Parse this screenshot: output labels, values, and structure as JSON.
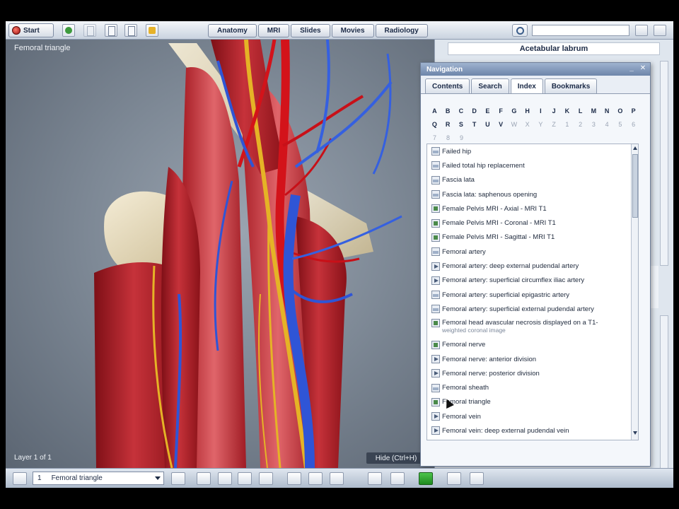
{
  "toolbar": {
    "start_label": "Start",
    "tabs": [
      "Anatomy",
      "MRI",
      "Slides",
      "Movies",
      "Radiology"
    ]
  },
  "viewer": {
    "title": "Femoral triangle",
    "footer_left": "Layer 1 of 1",
    "footer_right": "Hide (Ctrl+H)"
  },
  "right_pane": {
    "header": "Acetabular labrum"
  },
  "navigation": {
    "title": "Navigation",
    "tabs": [
      "Contents",
      "Search",
      "Index",
      "Bookmarks"
    ],
    "active_tab": "Index",
    "alphabet_row1": [
      "A",
      "B",
      "C",
      "D",
      "E",
      "F",
      "G",
      "H",
      "I",
      "J",
      "K",
      "L",
      "M",
      "N",
      "O",
      "P"
    ],
    "alphabet_row2": [
      "Q",
      "R",
      "S",
      "T",
      "U",
      "V",
      "W",
      "X",
      "Y",
      "Z",
      "1",
      "2",
      "3",
      "4",
      "5",
      "6"
    ],
    "alphabet_row3": [
      "7",
      "8",
      "9"
    ],
    "items": [
      {
        "label": "Failed hip",
        "icon": "image-icon"
      },
      {
        "label": "Failed total hip replacement",
        "icon": "image-icon"
      },
      {
        "label": "Fascia lata",
        "icon": "image-icon"
      },
      {
        "label": "Fascia lata: saphenous opening",
        "icon": "image-icon"
      },
      {
        "label": "Female Pelvis MRI - Axial - MRI T1",
        "icon": "mri-icon"
      },
      {
        "label": "Female Pelvis MRI - Coronal - MRI T1",
        "icon": "mri-icon"
      },
      {
        "label": "Female Pelvis MRI - Sagittal - MRI T1",
        "icon": "mri-icon"
      },
      {
        "label": "Femoral artery",
        "icon": "image-icon"
      },
      {
        "label": "Femoral artery: deep external pudendal artery",
        "icon": "video-icon"
      },
      {
        "label": "Femoral artery: superficial circumflex iliac artery",
        "icon": "video-icon"
      },
      {
        "label": "Femoral artery: superficial epigastric artery",
        "icon": "image-icon"
      },
      {
        "label": "Femoral artery: superficial external pudendal artery",
        "icon": "image-icon"
      },
      {
        "label": "Femoral head avascular necrosis displayed on a T1-",
        "sub": "weighted coronal image",
        "icon": "mri-icon"
      },
      {
        "label": "Femoral nerve",
        "icon": "mri-icon"
      },
      {
        "label": "Femoral nerve: anterior division",
        "icon": "video-icon"
      },
      {
        "label": "Femoral nerve: posterior division",
        "icon": "video-icon"
      },
      {
        "label": "Femoral sheath",
        "icon": "image-icon"
      },
      {
        "label": "Femoral triangle",
        "icon": "mri-icon"
      },
      {
        "label": "Femoral vein",
        "icon": "video-icon"
      },
      {
        "label": "Femoral vein: deep external pudendal vein",
        "icon": "video-icon"
      }
    ]
  },
  "bottombar": {
    "layer_number": "1",
    "layer_name": "Femoral triangle"
  },
  "colors": {
    "muscle": "#b8232b",
    "artery": "#d3131a",
    "vein": "#2f55d6",
    "nerve": "#e8b62a",
    "bone": "#e7dcc2"
  }
}
